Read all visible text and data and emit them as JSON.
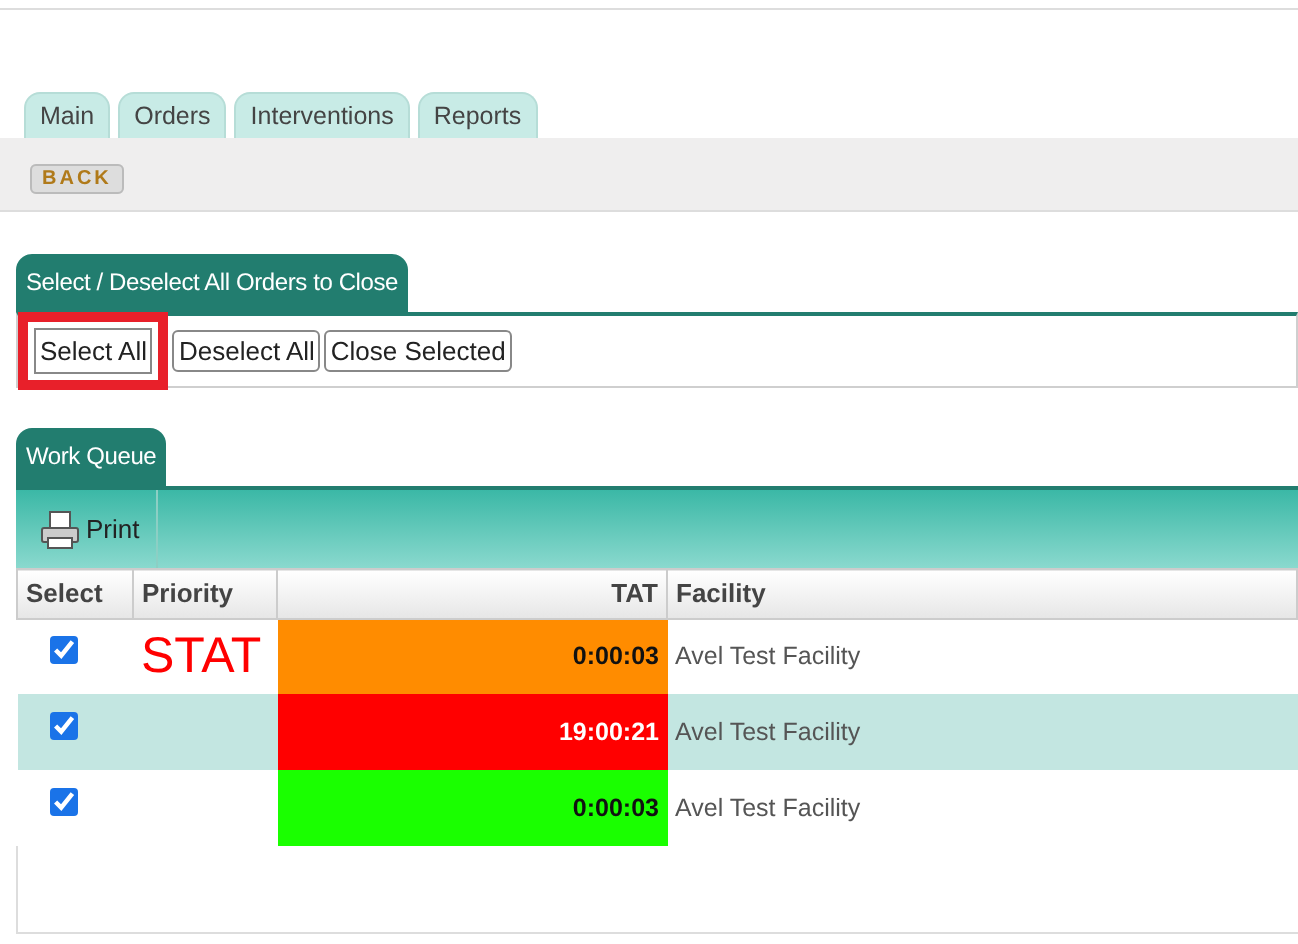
{
  "tabs": [
    {
      "label": "Main",
      "selected": false
    },
    {
      "label": "Orders",
      "selected": false
    },
    {
      "label": "Interventions",
      "selected": false
    },
    {
      "label": "Reports",
      "selected": false
    }
  ],
  "back_button": "BACK",
  "close_section": {
    "title": "Select / Deselect All Orders to Close",
    "buttons": [
      {
        "label": "Select All",
        "highlighted": true
      },
      {
        "label": "Deselect All",
        "highlighted": false
      },
      {
        "label": "Close Selected",
        "highlighted": false
      }
    ]
  },
  "work_queue": {
    "title": "Work Queue",
    "toolbar": [
      "Print"
    ],
    "columns": [
      "Select",
      "Priority",
      "TAT",
      "Facility"
    ],
    "rows": [
      {
        "checked": true,
        "highlighted": false,
        "priority": "STAT",
        "tat": "0:00:03",
        "color": "#ff8c00",
        "facility": "Avel Test Facility"
      },
      {
        "checked": true,
        "highlighted": true,
        "priority": "",
        "tat": "19:00:21",
        "color": "#ff0000",
        "facility": "Avel Test Facility"
      },
      {
        "checked": true,
        "highlighted": false,
        "priority": "",
        "tat": "0:00:03",
        "color": "#1aff00",
        "facility": "Avel Test Facility"
      }
    ]
  }
}
